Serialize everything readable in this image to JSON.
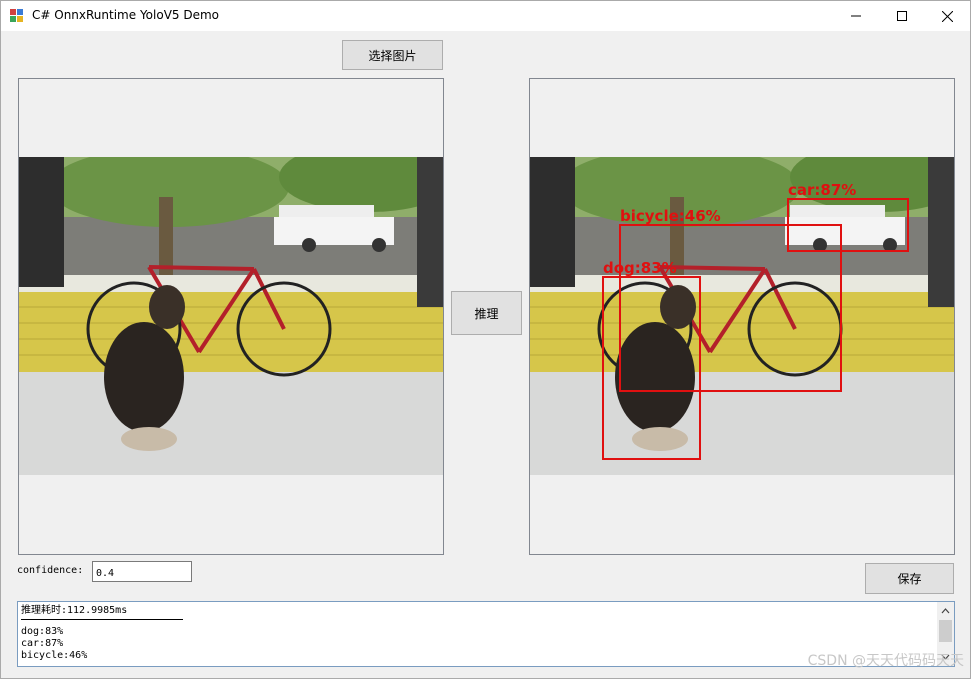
{
  "window": {
    "title": "C# OnnxRuntime YoloV5 Demo"
  },
  "toolbar": {
    "select_image_label": "选择图片",
    "infer_label": "推理",
    "save_label": "保存"
  },
  "confidence": {
    "label": "confidence:",
    "value": "0.4"
  },
  "output": {
    "title_line": "推理耗时:112.9985ms",
    "results": [
      "dog:83%",
      "car:87%",
      "bicycle:46%"
    ]
  },
  "detections": [
    {
      "label": "dog:83%"
    },
    {
      "label": "car:87%"
    },
    {
      "label": "bicycle:46%"
    }
  ],
  "colors": {
    "detection": "#e01010",
    "accent": "#0078d7"
  },
  "watermark": "CSDN @天天代码码天天"
}
